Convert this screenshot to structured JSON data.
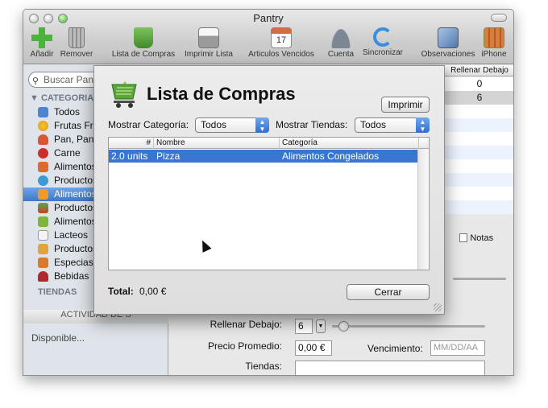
{
  "window": {
    "title": "Pantry"
  },
  "toolbar": {
    "items": [
      {
        "label": "Añadir",
        "icon": "plus-icon"
      },
      {
        "label": "Remover",
        "icon": "trash-icon"
      },
      {
        "label": "Lista de Compras",
        "icon": "cart-icon"
      },
      {
        "label": "Imprimir Lista",
        "icon": "printer-icon"
      },
      {
        "label": "Articulos Vencidos",
        "icon": "calendar-icon"
      },
      {
        "label": "Cuenta",
        "icon": "users-icon"
      },
      {
        "label": "Sincronizar",
        "icon": "sync-icon"
      },
      {
        "label": "Observaciones",
        "icon": "notepad-icon"
      },
      {
        "label": "iPhone",
        "icon": "iphone-icon"
      }
    ],
    "calendar_day": "17"
  },
  "sidebar": {
    "search_placeholder": "Buscar Pant",
    "categories_header": "CATEGORIAS",
    "categories": [
      {
        "label": "Todos"
      },
      {
        "label": "Frutas Fre"
      },
      {
        "label": "Pan, Pana"
      },
      {
        "label": "Carne"
      },
      {
        "label": "Alimentos"
      },
      {
        "label": "Productos"
      },
      {
        "label": "Alimentos"
      },
      {
        "label": "Productos"
      },
      {
        "label": "Alimentos"
      },
      {
        "label": "Lacteos"
      },
      {
        "label": "Productos"
      },
      {
        "label": "Especias,"
      },
      {
        "label": "Bebidas"
      }
    ],
    "tiendas_header": "TIENDAS",
    "activity_header": "ACTIVIDAD DE S",
    "status": "Disponible..."
  },
  "background_table": {
    "column": "Rellenar Debajo",
    "values": [
      "0",
      "6"
    ]
  },
  "detail_form": {
    "notas_tab": "Notas",
    "rellenar_label": "Rellenar Debajo:",
    "rellenar_value": "6",
    "precio_label": "Precio Promedio:",
    "precio_value": "0,00 €",
    "vencimiento_label": "Vencimiento:",
    "vencimiento_placeholder": "MM/DD/AA",
    "tiendas_label": "Tiendas:"
  },
  "sheet": {
    "title": "Lista de Compras",
    "print_button": "Imprimir",
    "categoria_label": "Mostrar Categoría:",
    "categoria_value": "Todos",
    "tiendas_label": "Mostrar Tiendas:",
    "tiendas_value": "Todos",
    "columns": {
      "num": "#",
      "nombre": "Nombre",
      "categoria": "Categoría"
    },
    "rows": [
      {
        "num": "2.0 units",
        "nombre": "Pizza",
        "categoria": "Alimentos Congelados"
      }
    ],
    "total_label": "Total:",
    "total_value": "0,00 €",
    "close_button": "Cerrar"
  }
}
